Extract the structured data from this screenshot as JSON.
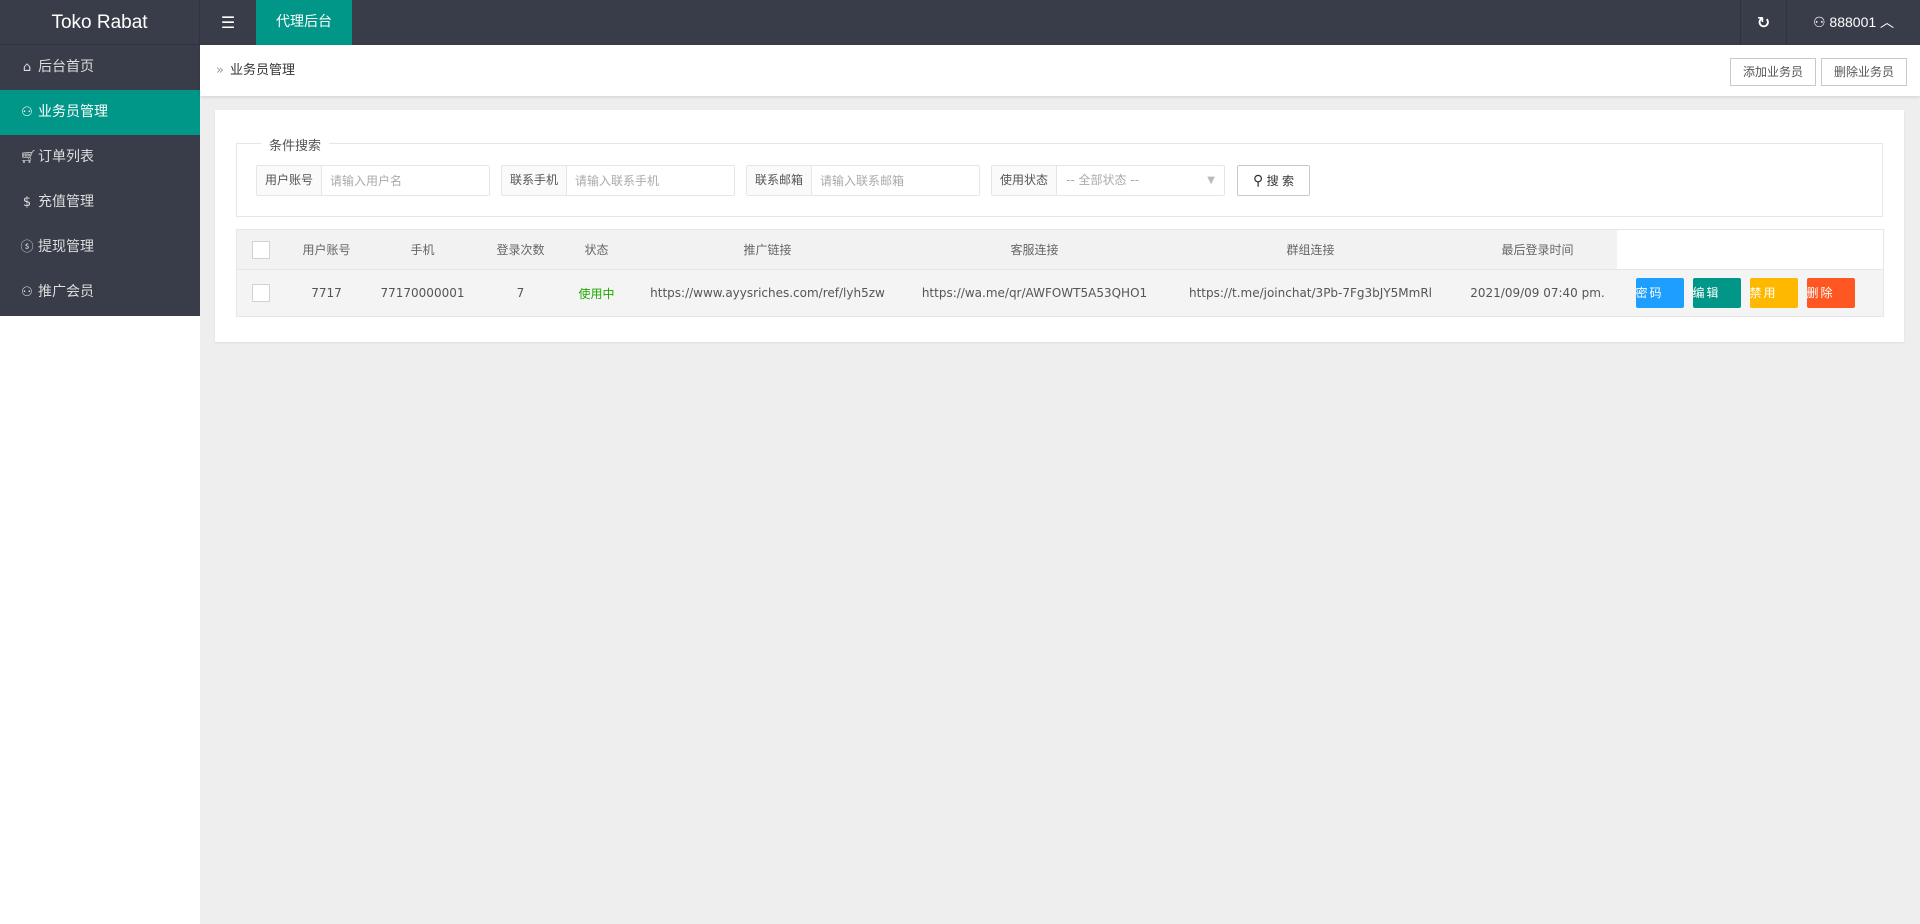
{
  "header": {
    "logo": "Toko Rabat",
    "menu_icon": "menu-toggle-icon",
    "tab": "代理后台",
    "refresh_icon": "refresh-icon",
    "user": "888001"
  },
  "sidebar": {
    "items": [
      {
        "label": "后台首页",
        "icon": "home-icon"
      },
      {
        "label": "业务员管理",
        "icon": "user-icon",
        "active": true
      },
      {
        "label": "订单列表",
        "icon": "cart-icon"
      },
      {
        "label": "充值管理",
        "icon": "dollar-icon"
      },
      {
        "label": "提现管理",
        "icon": "coin-icon"
      },
      {
        "label": "推广会员",
        "icon": "user-icon"
      }
    ]
  },
  "breadcrumb": {
    "current": "业务员管理",
    "add_button": "添加业务员",
    "delete_button": "删除业务员"
  },
  "search": {
    "legend": "条件搜索",
    "username": {
      "label": "用户账号",
      "placeholder": "请输入用户名"
    },
    "phone": {
      "label": "联系手机",
      "placeholder": "请输入联系手机"
    },
    "email": {
      "label": "联系邮箱",
      "placeholder": "请输入联系邮箱"
    },
    "status": {
      "label": "使用状态",
      "value": "-- 全部状态 --"
    },
    "button": "搜 索"
  },
  "table": {
    "columns": [
      "用户账号",
      "手机",
      "登录次数",
      "状态",
      "推广链接",
      "客服连接",
      "群组连接",
      "最后登录时间"
    ],
    "rows": [
      {
        "username": "7717",
        "phone": "77170000001",
        "logins": "7",
        "status": "使用中",
        "promo": "https://www.ayysriches.com/ref/lyh5zw",
        "support": "https://wa.me/qr/AWFOWT5A53QHO1",
        "group": "https://t.me/joinchat/3Pb-7Fg3bJY5MmRl",
        "last_login": "2021/09/09 07:40 pm."
      }
    ],
    "actions": [
      {
        "label": "密码",
        "color": "#1e9fff"
      },
      {
        "label": "编辑",
        "color": "#009688"
      },
      {
        "label": "禁用",
        "color": "#ffb800"
      },
      {
        "label": "删除",
        "color": "#ff5722"
      }
    ]
  }
}
